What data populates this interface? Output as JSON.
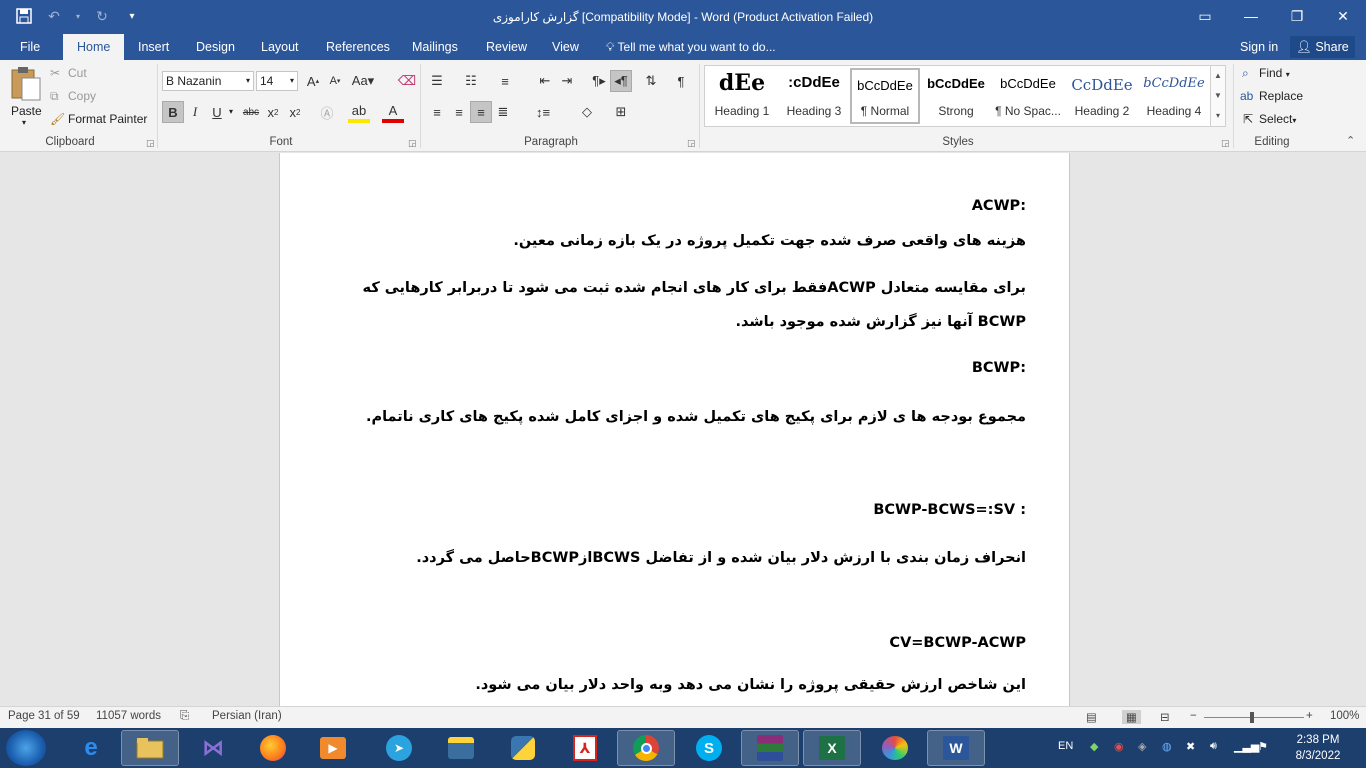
{
  "window": {
    "title": "گزارش کاراموزی [Compatibility Mode] - Word (Product Activation Failed)"
  },
  "ribbon_tabs": [
    "File",
    "Home",
    "Insert",
    "Design",
    "Layout",
    "References",
    "Mailings",
    "Review",
    "View"
  ],
  "tellme": "Tell me what you want to do...",
  "account": {
    "signin": "Sign in",
    "share": "Share"
  },
  "clipboard": {
    "paste": "Paste",
    "cut": "Cut",
    "copy": "Copy",
    "format_painter": "Format Painter",
    "label": "Clipboard"
  },
  "font": {
    "name": "B Nazanin",
    "size": "14",
    "label": "Font"
  },
  "paragraph": {
    "label": "Paragraph"
  },
  "styles": {
    "label": "Styles",
    "items": [
      {
        "sample": "dEe",
        "name": "Heading 1"
      },
      {
        "sample": ":cDdEe",
        "name": "Heading 3"
      },
      {
        "sample": "bCcDdEe",
        "name": "¶ Normal"
      },
      {
        "sample": "bCcDdEe",
        "name": "Strong"
      },
      {
        "sample": "bCcDdEe",
        "name": "¶ No Spac..."
      },
      {
        "sample": "CcDdEe",
        "name": "Heading 2"
      },
      {
        "sample": "bCcDdEe",
        "name": "Heading 4"
      }
    ]
  },
  "editing": {
    "find": "Find",
    "replace": "Replace",
    "select": "Select",
    "label": "Editing"
  },
  "document": {
    "paragraphs": [
      {
        "text": ":ACWP",
        "bold": true
      },
      {
        "text": "هزینه های واقعی صرف شده جهت تکمیل پروژه در یک بازه زمانی معین.",
        "bold": true
      },
      {
        "text": "برای مقایسه متعادل ACWPفقط برای کار های انجام شده ثبت می شود تا دربرابر کارهایی که BCWP آنها نیز گزارش شده موجود باشد.",
        "bold": true
      },
      {
        "text": ":BCWP",
        "bold": true
      },
      {
        "text": "مجموع بودجه ها ی لازم برای پکیج های تکمیل شده و اجزای کامل  شده پکیج های کاری ناتمام.",
        "bold": true
      },
      {
        "text": ": BCWP-BCWS=:SV",
        "bold": true
      },
      {
        "text": "انحراف زمان بندی با ارزش دلار بیان شده و از تفاضل BCWSازBCWPحاصل می گردد.",
        "bold": true
      },
      {
        "text": "CV=BCWP-ACWP",
        "bold": true
      },
      {
        "text": "این شاخص ارزش حقیقی پروژه را نشان می دهد وبه واحد دلار بیان می شود.",
        "bold": true
      }
    ]
  },
  "status": {
    "page": "Page 31 of 59",
    "words": "11057 words",
    "language": "Persian (Iran)",
    "zoom": "100%"
  },
  "taskbar": {
    "lang": "EN",
    "time": "2:38 PM",
    "date": "8/3/2022"
  }
}
